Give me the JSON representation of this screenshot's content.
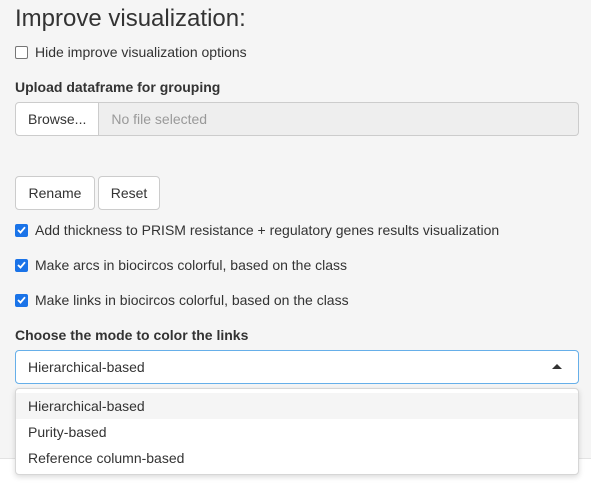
{
  "section": {
    "title": "Improve visualization:"
  },
  "hide_option": {
    "label": "Hide improve visualization options",
    "checked": false
  },
  "upload": {
    "label": "Upload dataframe for grouping",
    "browse_label": "Browse...",
    "file_status": "No file selected"
  },
  "actions": {
    "rename_label": "Rename",
    "reset_label": "Reset"
  },
  "options": [
    {
      "label": "Add thickness to PRISM resistance + regulatory genes results visualization",
      "checked": true
    },
    {
      "label": "Make arcs in biocircos colorful, based on the class",
      "checked": true
    },
    {
      "label": "Make links in biocircos colorful, based on the class",
      "checked": true
    }
  ],
  "link_mode": {
    "label": "Choose the mode to color the links",
    "selected": "Hierarchical-based",
    "dropdown_open": true,
    "choices": [
      "Hierarchical-based",
      "Purity-based",
      "Reference column-based"
    ]
  },
  "colors": {
    "checkbox_accent": "#1a73e8",
    "focus_border": "#66afe9",
    "background": "#f5f5f5"
  }
}
